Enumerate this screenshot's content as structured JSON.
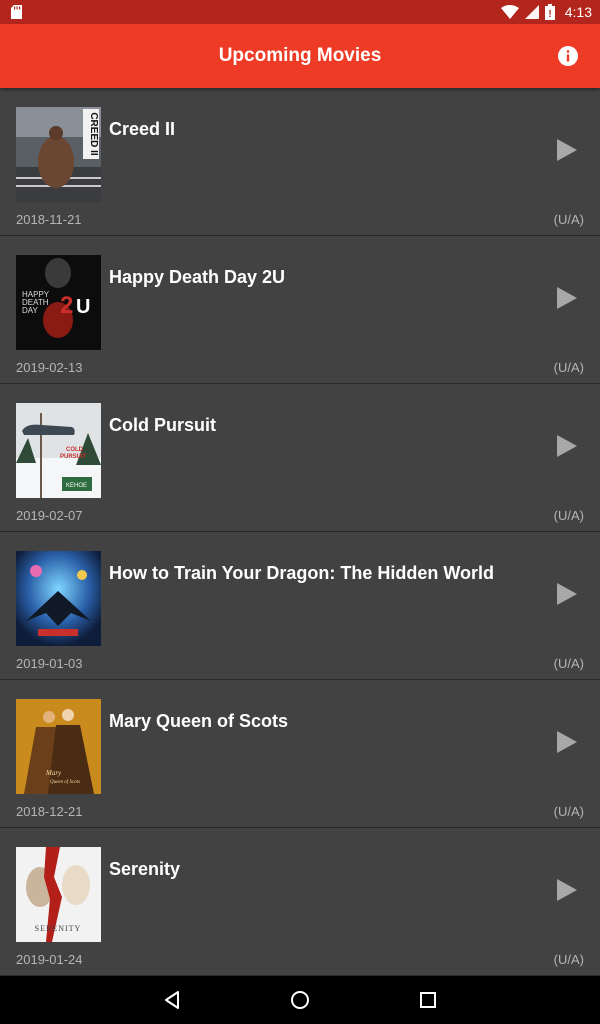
{
  "status_bar": {
    "time": "4:13",
    "icons": [
      "sd-card-icon",
      "wifi-icon",
      "cell-signal-icon",
      "battery-icon"
    ]
  },
  "app_bar": {
    "title": "Upcoming Movies",
    "info_icon": "info-icon"
  },
  "colors": {
    "status_bar": "#b3261e",
    "app_bar": "#ee3b25",
    "list_background": "#424242",
    "nav_bar": "#000000"
  },
  "movies": [
    {
      "title": "Creed II",
      "date": "2018-11-21",
      "rating": "(U/A)",
      "poster_text": "CREED II"
    },
    {
      "title": "Happy Death Day 2U",
      "date": "2019-02-13",
      "rating": "(U/A)",
      "poster_text": "HAPPY DEATH DAY 2U"
    },
    {
      "title": "Cold Pursuit",
      "date": "2019-02-07",
      "rating": "(U/A)",
      "poster_text": "COLD PURSUIT"
    },
    {
      "title": "How to Train Your Dragon: The Hidden World",
      "date": "2019-01-03",
      "rating": "(U/A)",
      "poster_text": ""
    },
    {
      "title": "Mary Queen of Scots",
      "date": "2018-12-21",
      "rating": "(U/A)",
      "poster_text": ""
    },
    {
      "title": "Serenity",
      "date": "2019-01-24",
      "rating": "(U/A)",
      "poster_text": "SERENITY"
    }
  ],
  "nav_bar": {
    "buttons": [
      "back-icon",
      "home-icon",
      "recents-icon"
    ]
  }
}
